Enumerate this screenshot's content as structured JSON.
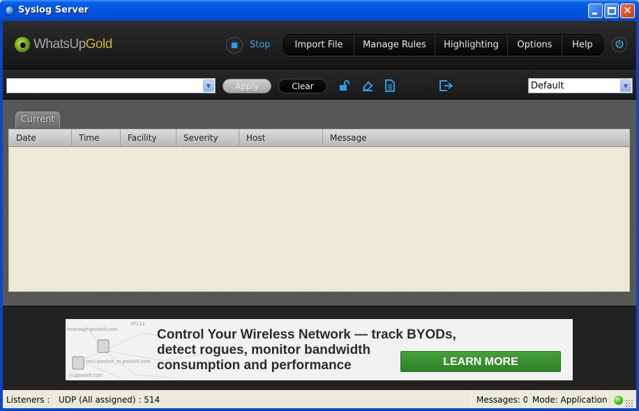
{
  "window": {
    "title": "Syslog Server"
  },
  "header": {
    "logo_text_a": "WhatsUp",
    "logo_text_b": "Gold",
    "stop_label": "Stop",
    "nav": [
      "Import File",
      "Manage Rules",
      "Highlighting",
      "Options",
      "Help"
    ]
  },
  "toolbar": {
    "filter_value": "",
    "apply_label": "Apply",
    "clear_label": "Clear",
    "profile_value": "Default"
  },
  "main": {
    "tab_label": "Current",
    "columns": [
      "Date",
      "Time",
      "Facility",
      "Severity",
      "Host",
      "Message"
    ]
  },
  "ad": {
    "line1": "Control Your Wireless Network — track BYODs,",
    "line2": "detect rogues, monitor bandwidth",
    "line3": "consumption and performance",
    "button_label": "LEARN MORE"
  },
  "status": {
    "listeners_label": "Listeners :",
    "listeners_value": "UDP  (All assigned) : 514",
    "messages": "Messages: 0",
    "mode": "Mode: Application"
  },
  "colors": {
    "accent_blue": "#2e9ee9",
    "ad_button_green": "#3a9132",
    "grid_background": "#ece9d8"
  },
  "icons": [
    "unlock-icon",
    "eraser-icon",
    "document-icon",
    "export-icon",
    "power-icon",
    "stop-icon",
    "status-led-icon"
  ]
}
